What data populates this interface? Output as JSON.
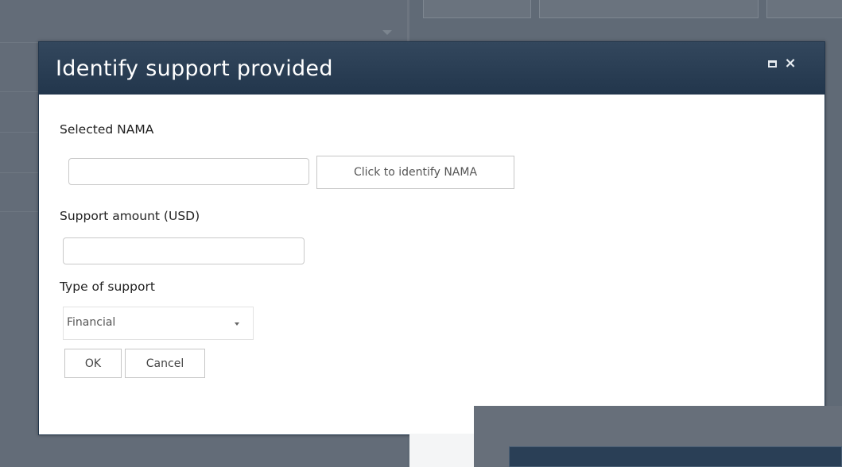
{
  "dialog": {
    "title": "Identify support provided",
    "maximize_icon": "maximize-icon",
    "close_icon": "close-icon",
    "close_glyph": "×"
  },
  "form": {
    "selected_nama": {
      "label": "Selected NAMA",
      "value": "",
      "button_label": "Click to identify NAMA"
    },
    "support_amount": {
      "label": "Support amount (USD)",
      "value": ""
    },
    "type_of_support": {
      "label": "Type of support",
      "selected": "Financial",
      "icon": "chevron-down-icon"
    },
    "actions": {
      "ok_label": "OK",
      "cancel_label": "Cancel"
    }
  },
  "colors": {
    "titlebar": "#22364c",
    "overlay": "#606a76",
    "dialog_bg": "#ffffff"
  }
}
